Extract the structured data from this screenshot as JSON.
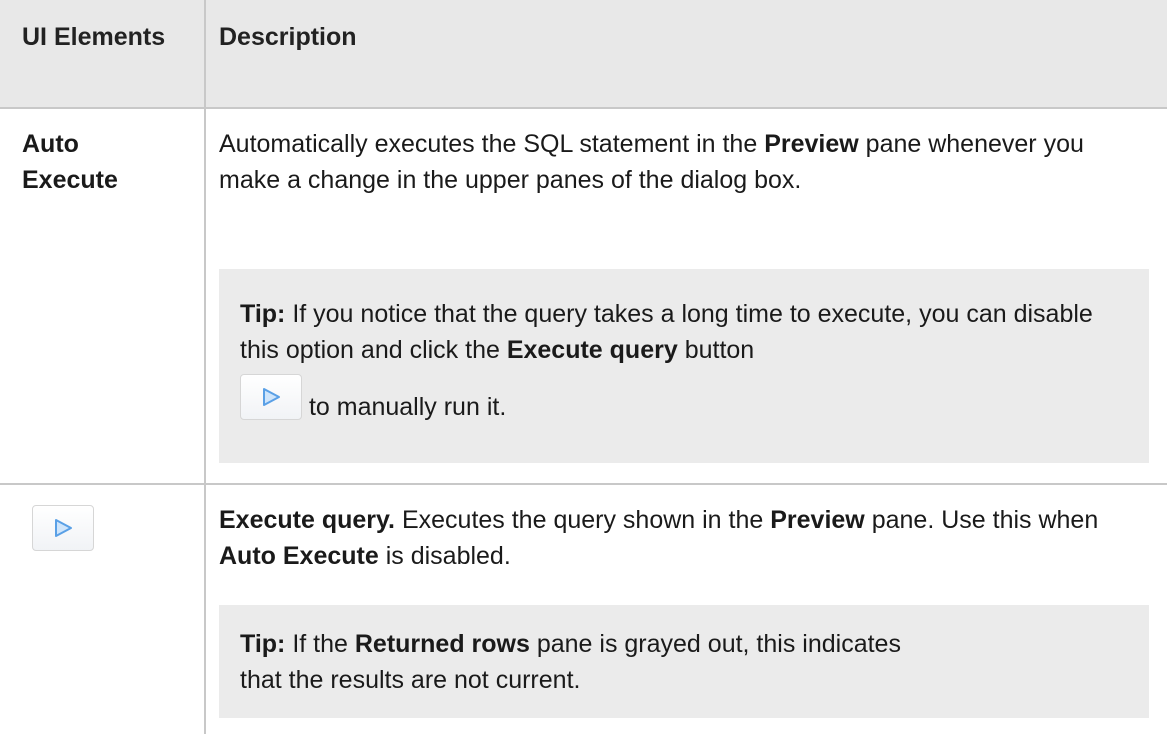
{
  "table": {
    "headers": {
      "ui_elements": "UI Elements",
      "description": "Description"
    },
    "rows": [
      {
        "element": "Auto Execute",
        "description_parts": {
          "p1": "Automatically executes the SQL statement in the ",
          "b1": "Preview",
          "p2": " pane whenever you make a change in the upper panes of the dialog box."
        },
        "tip": {
          "label": "Tip:",
          "p1": " If you notice that the query takes a long time to execute, you can disable this option and click the ",
          "b1": "Execute query",
          "p2": " button",
          "p3": " to manually run it."
        }
      },
      {
        "element_icon": "play-icon",
        "description_parts": {
          "b0": "Execute query.",
          "p1": " Executes the query shown in the ",
          "b1": "Preview",
          "p2": " pane. Use this when ",
          "b2": "Auto Execute",
          "p3": " is disabled."
        },
        "tip": {
          "label": "Tip:",
          "p1": " If the ",
          "b1": "Returned rows",
          "p2": " pane is grayed out, this indicates that the results are not current."
        }
      }
    ]
  },
  "colors": {
    "header_bg": "#e8e8e8",
    "tip_bg": "#ebebeb",
    "border": "#c8c8c8",
    "icon_blue": "#5aa0e6"
  }
}
